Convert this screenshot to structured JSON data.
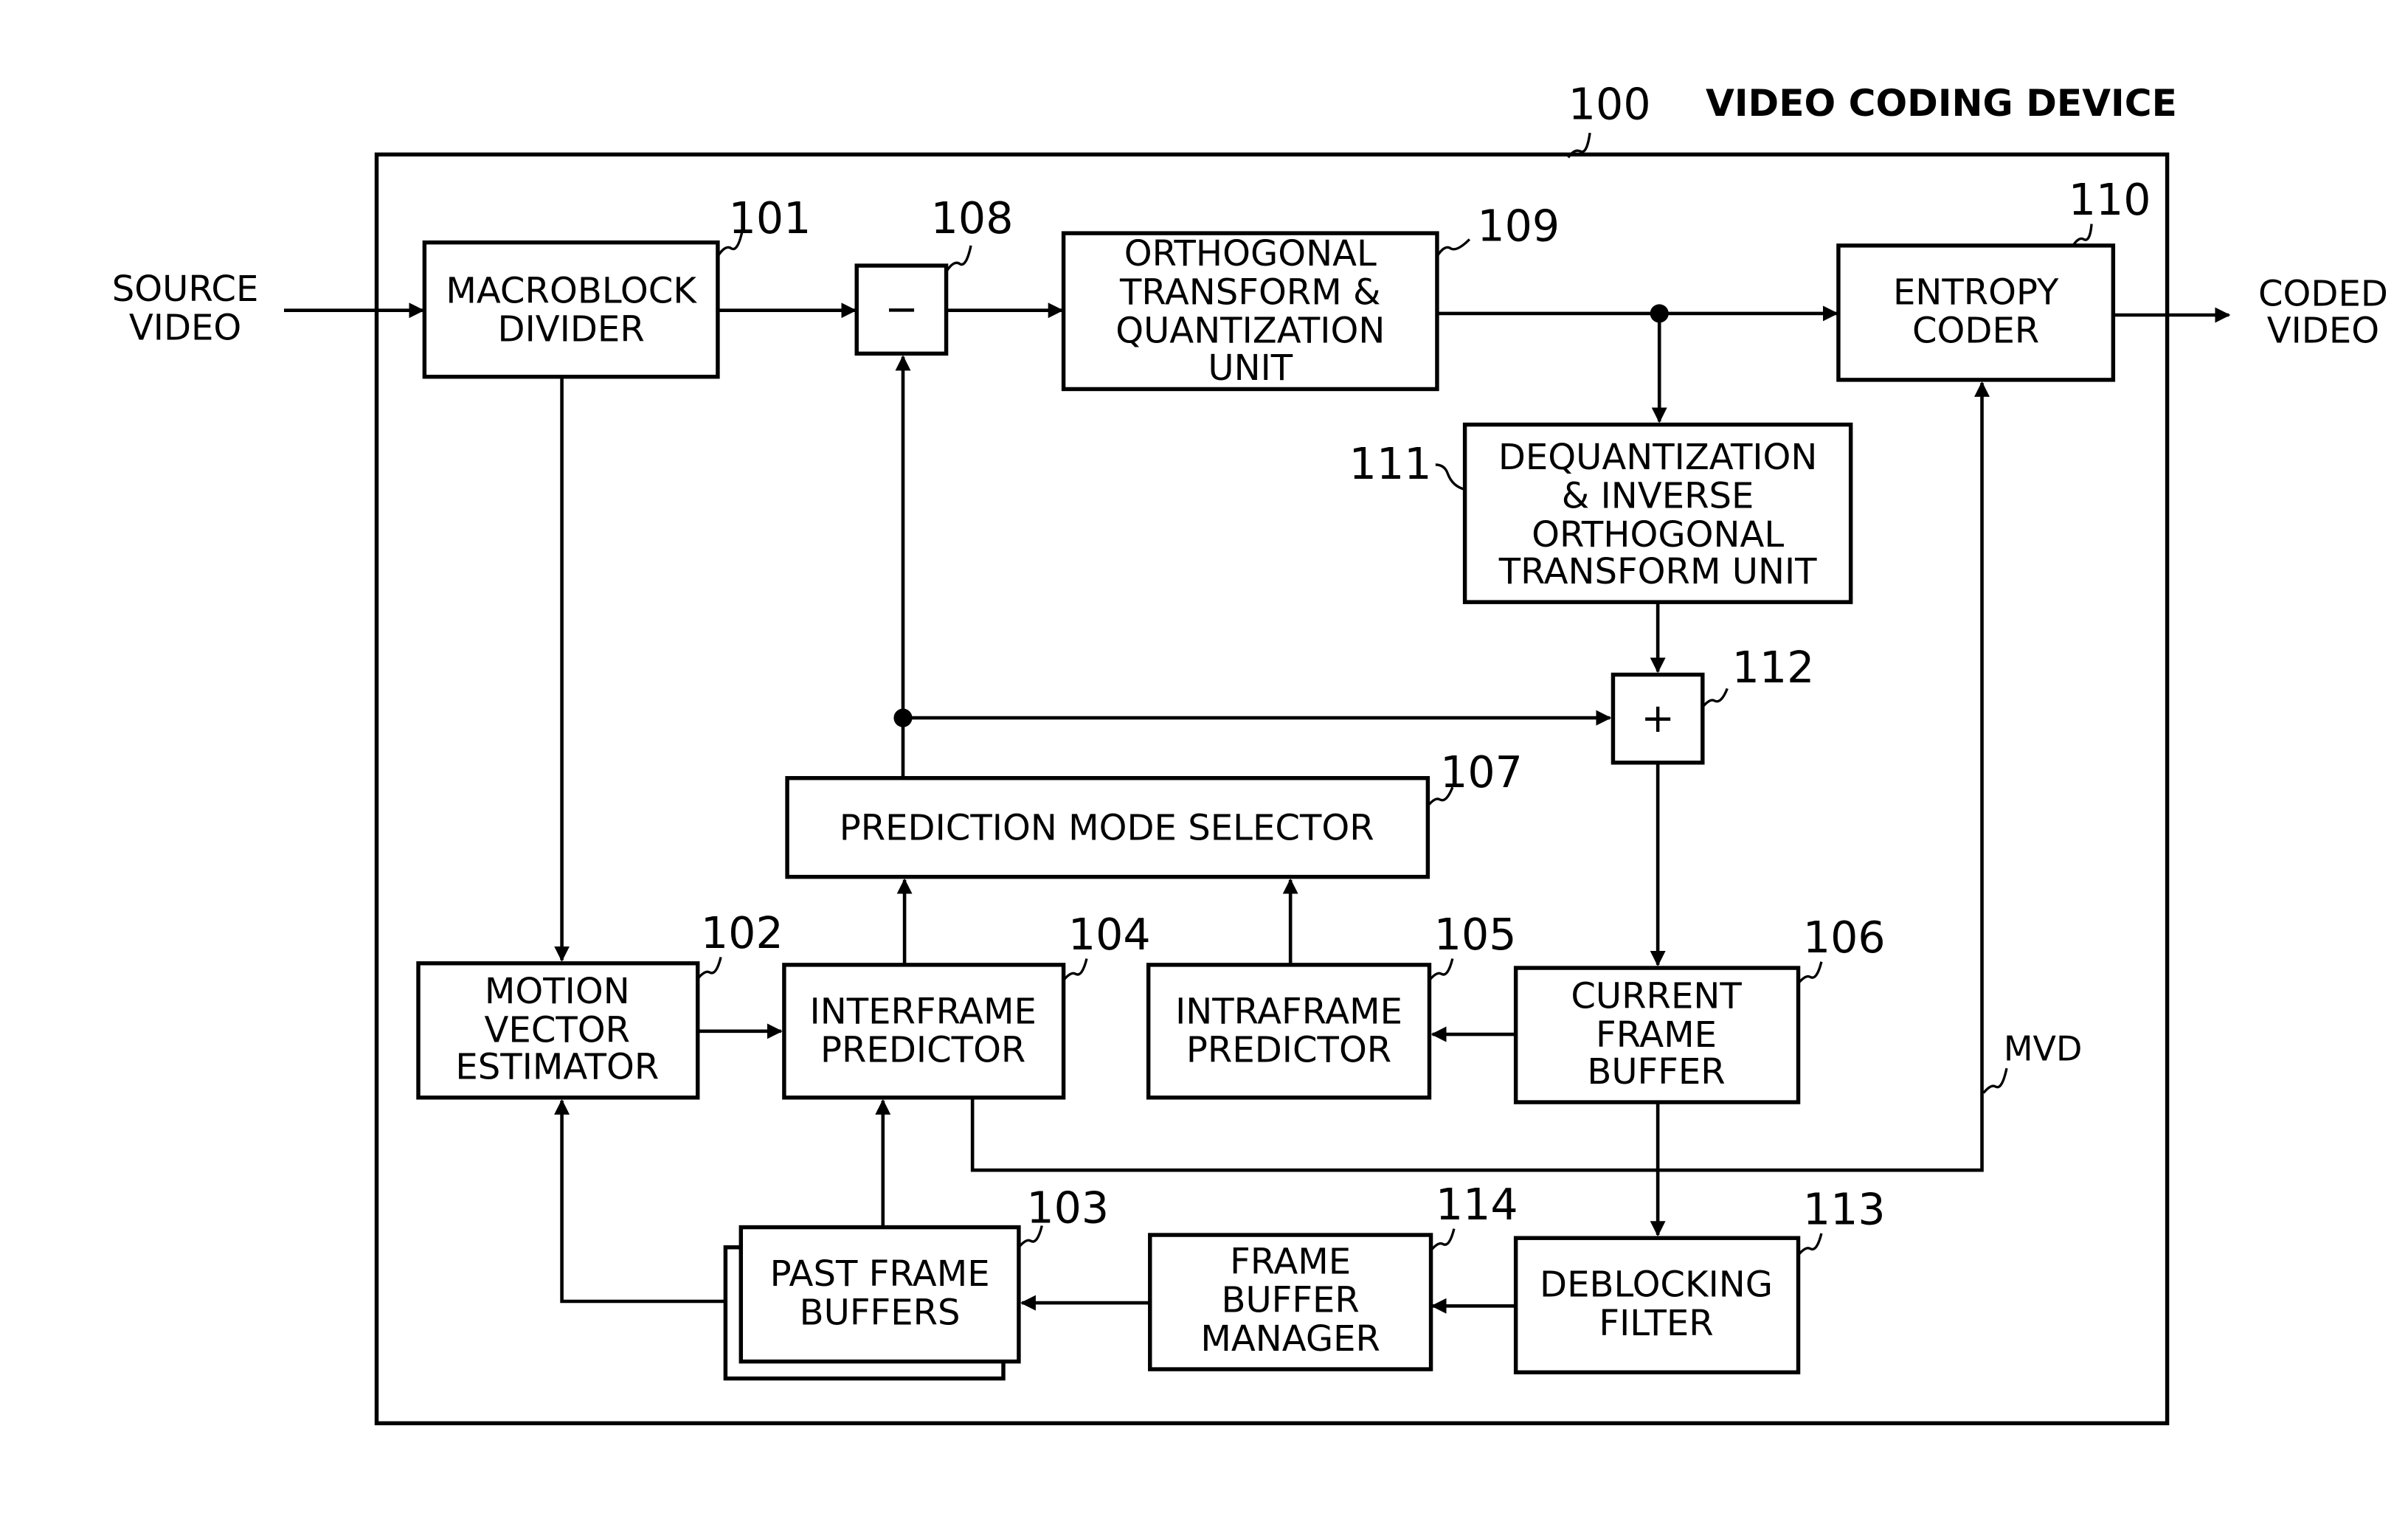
{
  "title": "VIDEO CODING DEVICE",
  "device_ref": "100",
  "inputs": {
    "source": [
      "SOURCE",
      "VIDEO"
    ]
  },
  "outputs": {
    "coded": [
      "CODED",
      "VIDEO"
    ]
  },
  "blocks": {
    "b101": {
      "ref": "101",
      "lines": [
        "MACROBLOCK",
        "DIVIDER"
      ]
    },
    "b108": {
      "ref": "108",
      "symbol": "−"
    },
    "b109": {
      "ref": "109",
      "lines": [
        "ORTHOGONAL",
        "TRANSFORM &",
        "QUANTIZATION",
        "UNIT"
      ]
    },
    "b110": {
      "ref": "110",
      "lines": [
        "ENTROPY",
        "CODER"
      ]
    },
    "b111": {
      "ref": "111",
      "lines": [
        "DEQUANTIZATION",
        "& INVERSE",
        "ORTHOGONAL",
        "TRANSFORM UNIT"
      ]
    },
    "b112": {
      "ref": "112",
      "symbol": "+"
    },
    "b107": {
      "ref": "107",
      "lines": [
        "PREDICTION MODE SELECTOR"
      ]
    },
    "b102": {
      "ref": "102",
      "lines": [
        "MOTION",
        "VECTOR",
        "ESTIMATOR"
      ]
    },
    "b104": {
      "ref": "104",
      "lines": [
        "INTERFRAME",
        "PREDICTOR"
      ]
    },
    "b105": {
      "ref": "105",
      "lines": [
        "INTRAFRAME",
        "PREDICTOR"
      ]
    },
    "b106": {
      "ref": "106",
      "lines": [
        "CURRENT",
        "FRAME",
        "BUFFER"
      ]
    },
    "b103": {
      "ref": "103",
      "lines": [
        "PAST FRAME",
        "BUFFERS"
      ]
    },
    "b114": {
      "ref": "114",
      "lines": [
        "FRAME",
        "BUFFER",
        "MANAGER"
      ]
    },
    "b113": {
      "ref": "113",
      "lines": [
        "DEBLOCKING",
        "FILTER"
      ]
    }
  },
  "signals": {
    "mvd": "MVD"
  }
}
